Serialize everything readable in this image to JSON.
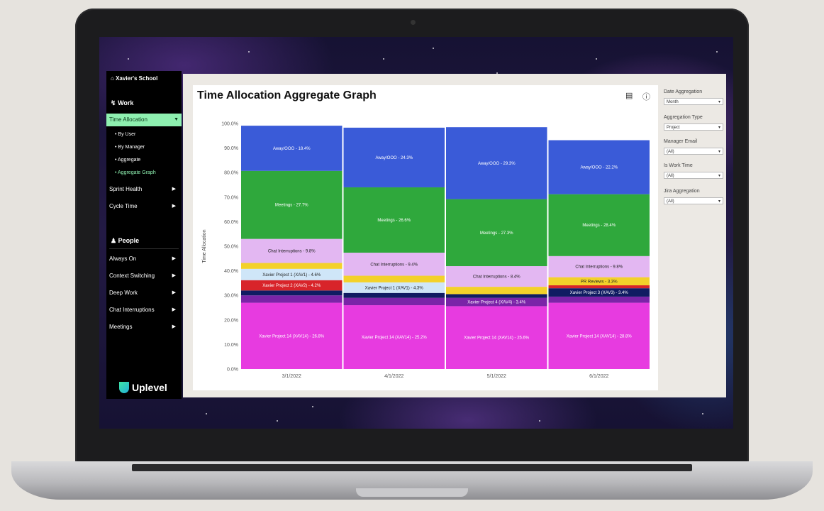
{
  "sidebar": {
    "school": "Xavier's School",
    "work_heading": "Work",
    "work_items": [
      {
        "label": "Time Allocation",
        "active": true
      },
      {
        "label": "Sprint Health"
      },
      {
        "label": "Cycle Time"
      }
    ],
    "sub_items": [
      "By User",
      "By Manager",
      "Aggregate",
      "Aggregate Graph"
    ],
    "people_heading": "People",
    "people_items": [
      "Always On",
      "Context Switching",
      "Deep Work",
      "Chat Interruptions",
      "Meetings"
    ],
    "logo": "Uplevel"
  },
  "header": {
    "title": "Time Allocation Aggregate Graph"
  },
  "filters": [
    {
      "label": "Date Aggregation",
      "value": "Month"
    },
    {
      "label": "Aggregation Type",
      "value": "Project"
    },
    {
      "label": "Manager Email",
      "value": "(All)"
    },
    {
      "label": "Is Work Time",
      "value": "(All)"
    },
    {
      "label": "Jira Aggregation",
      "value": "(All)"
    }
  ],
  "colors": {
    "away": "#3a5bd8",
    "meetings": "#2fa83c",
    "chat": "#e3b7f2",
    "yellow": "#f3d12a",
    "lightblue": "#cfe6f8",
    "red": "#d8242a",
    "navy": "#101c62",
    "purple": "#7a24a8",
    "magenta": "#e73be0",
    "accent": "#8ef0b0"
  },
  "chart_data": {
    "type": "bar",
    "stacked": true,
    "ylabel": "Time Allocation",
    "ylim": [
      0,
      100
    ],
    "yticks": [
      "0.0%",
      "10.0%",
      "20.0%",
      "30.0%",
      "40.0%",
      "50.0%",
      "60.0%",
      "70.0%",
      "80.0%",
      "90.0%",
      "100.0%"
    ],
    "categories": [
      "3/1/2022",
      "4/1/2022",
      "5/1/2022",
      "6/1/2022"
    ],
    "bars": [
      {
        "category": "3/1/2022",
        "segments": [
          {
            "color": "magenta",
            "value": 27,
            "label": "Xavier Project 14 (XAV14) - 26.8%"
          },
          {
            "color": "purple",
            "value": 3
          },
          {
            "color": "navy",
            "value": 2
          },
          {
            "color": "red",
            "value": 4.2,
            "label": "Xavier Project 2 (XAV2) - 4.2%"
          },
          {
            "color": "lightblue",
            "value": 4.6,
            "label": "Xavier Project 1 (XAV1) - 4.6%"
          },
          {
            "color": "yellow",
            "value": 2.4
          },
          {
            "color": "chat",
            "value": 9.8,
            "label": "Chat Interruptions - 9.8%"
          },
          {
            "color": "meetings",
            "value": 27.7,
            "label": "Meetings - 27.7%"
          },
          {
            "color": "away",
            "value": 18.4,
            "label": "Away/OOO - 18.4%"
          }
        ]
      },
      {
        "category": "4/1/2022",
        "segments": [
          {
            "color": "magenta",
            "value": 26,
            "label": "Xavier Project 14 (XAV14) - 25.2%"
          },
          {
            "color": "purple",
            "value": 3
          },
          {
            "color": "navy",
            "value": 2
          },
          {
            "color": "lightblue",
            "value": 4.3,
            "label": "Xavier Project 1 (XAV1) - 4.3%"
          },
          {
            "color": "yellow",
            "value": 2.7
          },
          {
            "color": "chat",
            "value": 9.4,
            "label": "Chat Interruptions - 9.4%"
          },
          {
            "color": "meetings",
            "value": 26.6,
            "label": "Meetings - 26.6%"
          },
          {
            "color": "away",
            "value": 24.3,
            "label": "Away/OOO - 24.3%"
          }
        ]
      },
      {
        "category": "5/1/2022",
        "segments": [
          {
            "color": "magenta",
            "value": 25.6,
            "label": "Xavier Project 14 (XAV14) - 25.6%"
          },
          {
            "color": "purple",
            "value": 3.4,
            "label": "Xavier Project 4 (XAV4) - 3.4%"
          },
          {
            "color": "navy",
            "value": 1.5
          },
          {
            "color": "yellow",
            "value": 3
          },
          {
            "color": "chat",
            "value": 8.4,
            "label": "Chat Interruptions - 8.4%"
          },
          {
            "color": "meetings",
            "value": 27.3,
            "label": "Meetings - 27.3%"
          },
          {
            "color": "away",
            "value": 29.3,
            "label": "Away/OOO - 29.3%"
          }
        ]
      },
      {
        "category": "6/1/2022",
        "segments": [
          {
            "color": "magenta",
            "value": 27,
            "label": "Xavier Project 14 (XAV14) - 28.8%"
          },
          {
            "color": "purple",
            "value": 2.5
          },
          {
            "color": "navy",
            "value": 3.4,
            "label": "Xavier Project 3 (XAV3) - 3.4%"
          },
          {
            "color": "red",
            "value": 1.2
          },
          {
            "color": "yellow",
            "value": 3.3,
            "label": "PR Reviews - 3.3%"
          },
          {
            "color": "chat",
            "value": 8.6,
            "label": "Chat Interruptions - 9.8%"
          },
          {
            "color": "meetings",
            "value": 25.2,
            "label": "Meetings - 28.4%"
          },
          {
            "color": "away",
            "value": 22,
            "label": "Away/OOO - 22.2%"
          }
        ]
      }
    ]
  }
}
